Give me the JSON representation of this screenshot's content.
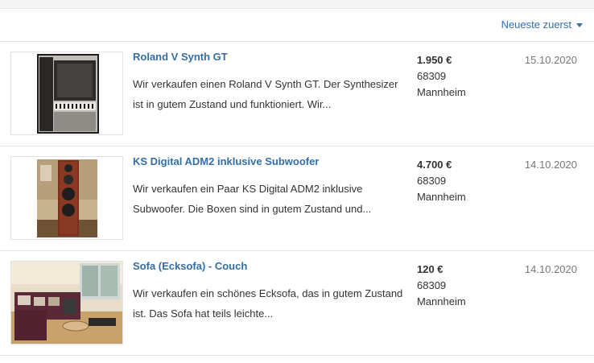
{
  "sort": {
    "label": "Neueste zuerst",
    "icon": "caret-down-icon"
  },
  "listings": [
    {
      "title": "Roland V Synth GT",
      "desc_line1": "Wir verkaufen einen Roland V Synth GT. Der Synthesizer",
      "desc_line2": "ist in gutem Zustand und funktioniert. Wir...",
      "price": "1.950 €",
      "zip": "68309",
      "city": "Mannheim",
      "date": "15.10.2020",
      "image": "synthesizer-case-photo"
    },
    {
      "title": "KS Digital ADM2 inklusive Subwoofer",
      "desc_line1": "Wir verkaufen ein Paar KS Digital ADM2 inklusive",
      "desc_line2": "Subwoofer. Die Boxen sind in gutem Zustand und...",
      "price": "4.700 €",
      "zip": "68309",
      "city": "Mannheim",
      "date": "14.10.2020",
      "image": "speaker-photo"
    },
    {
      "title": "Sofa (Ecksofa) - Couch",
      "desc_line1": "Wir verkaufen ein schönes Ecksofa, das in gutem Zustand",
      "desc_line2": "ist. Das Sofa hat teils leichte...",
      "price": "120 €",
      "zip": "68309",
      "city": "Mannheim",
      "date": "14.10.2020",
      "image": "corner-sofa-photo"
    }
  ]
}
